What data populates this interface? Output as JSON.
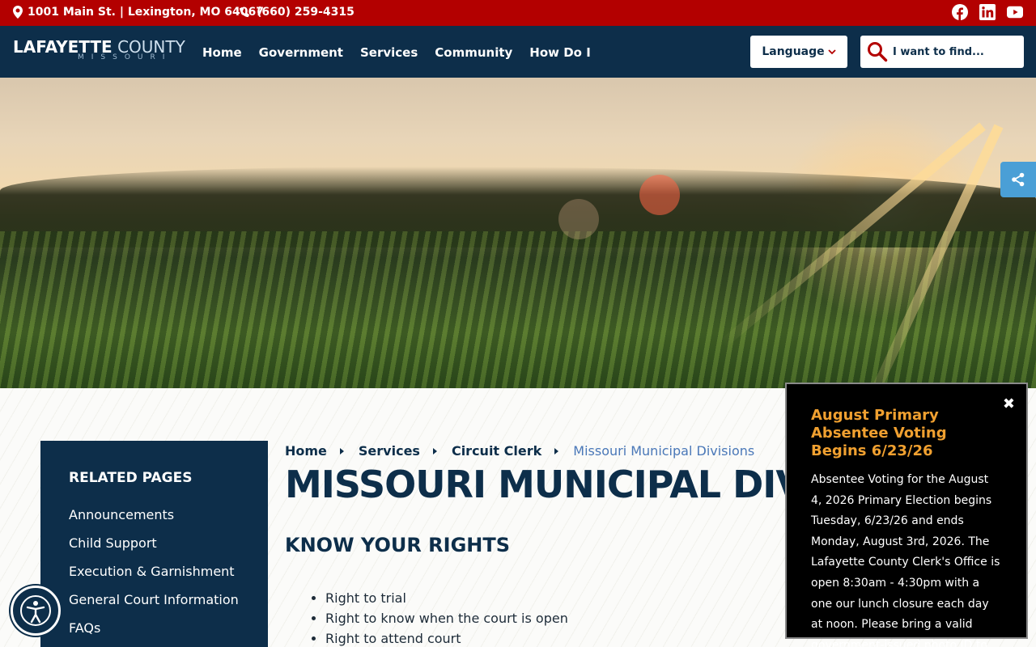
{
  "topbar": {
    "address": "1001 Main St. | Lexington, MO 64067",
    "phone": "(660) 259-4315",
    "social": [
      "facebook-icon",
      "linkedin-icon",
      "youtube-icon"
    ]
  },
  "header": {
    "logo_line1_bold": "LAFAYETTE",
    "logo_line1_light": " COUNTY",
    "logo_line2": "MISSOURI",
    "nav": [
      "Home",
      "Government",
      "Services",
      "Community",
      "How Do I"
    ],
    "language_label": "Language",
    "search_placeholder": "I want to find..."
  },
  "sidebar": {
    "title": "RELATED PAGES",
    "items": [
      "Announcements",
      "Child Support",
      "Execution & Garnishment",
      "General Court Information",
      "FAQs"
    ]
  },
  "breadcrumb": {
    "items": [
      "Home",
      "Services",
      "Circuit Clerk"
    ],
    "current": "Missouri Municipal Divisions"
  },
  "main": {
    "title": "MISSOURI MUNICIPAL DIVISIONS",
    "section_title": "KNOW YOUR RIGHTS",
    "rights": [
      "Right to trial",
      "Right to know when the court is open",
      "Right to attend court"
    ]
  },
  "alert": {
    "title": "August Primary Absentee Voting Begins 6/23/26",
    "body": "Absentee Voting for the August 4, 2026 Primary Election begins Tuesday, 6/23/26 and ends Monday, August 3rd, 2026. The Lafayette County Clerk's Office is open 8:30am - 4:30pm with a one our lunch closure each day at noon. Please bring a valid government-issued photo ID to vote.",
    "close_glyph": "✖"
  },
  "colors": {
    "brand_red": "#b30000",
    "brand_navy": "#0d2e4a",
    "alert_title": "#f0a030",
    "breadcrumb_current": "#4a78b8"
  }
}
